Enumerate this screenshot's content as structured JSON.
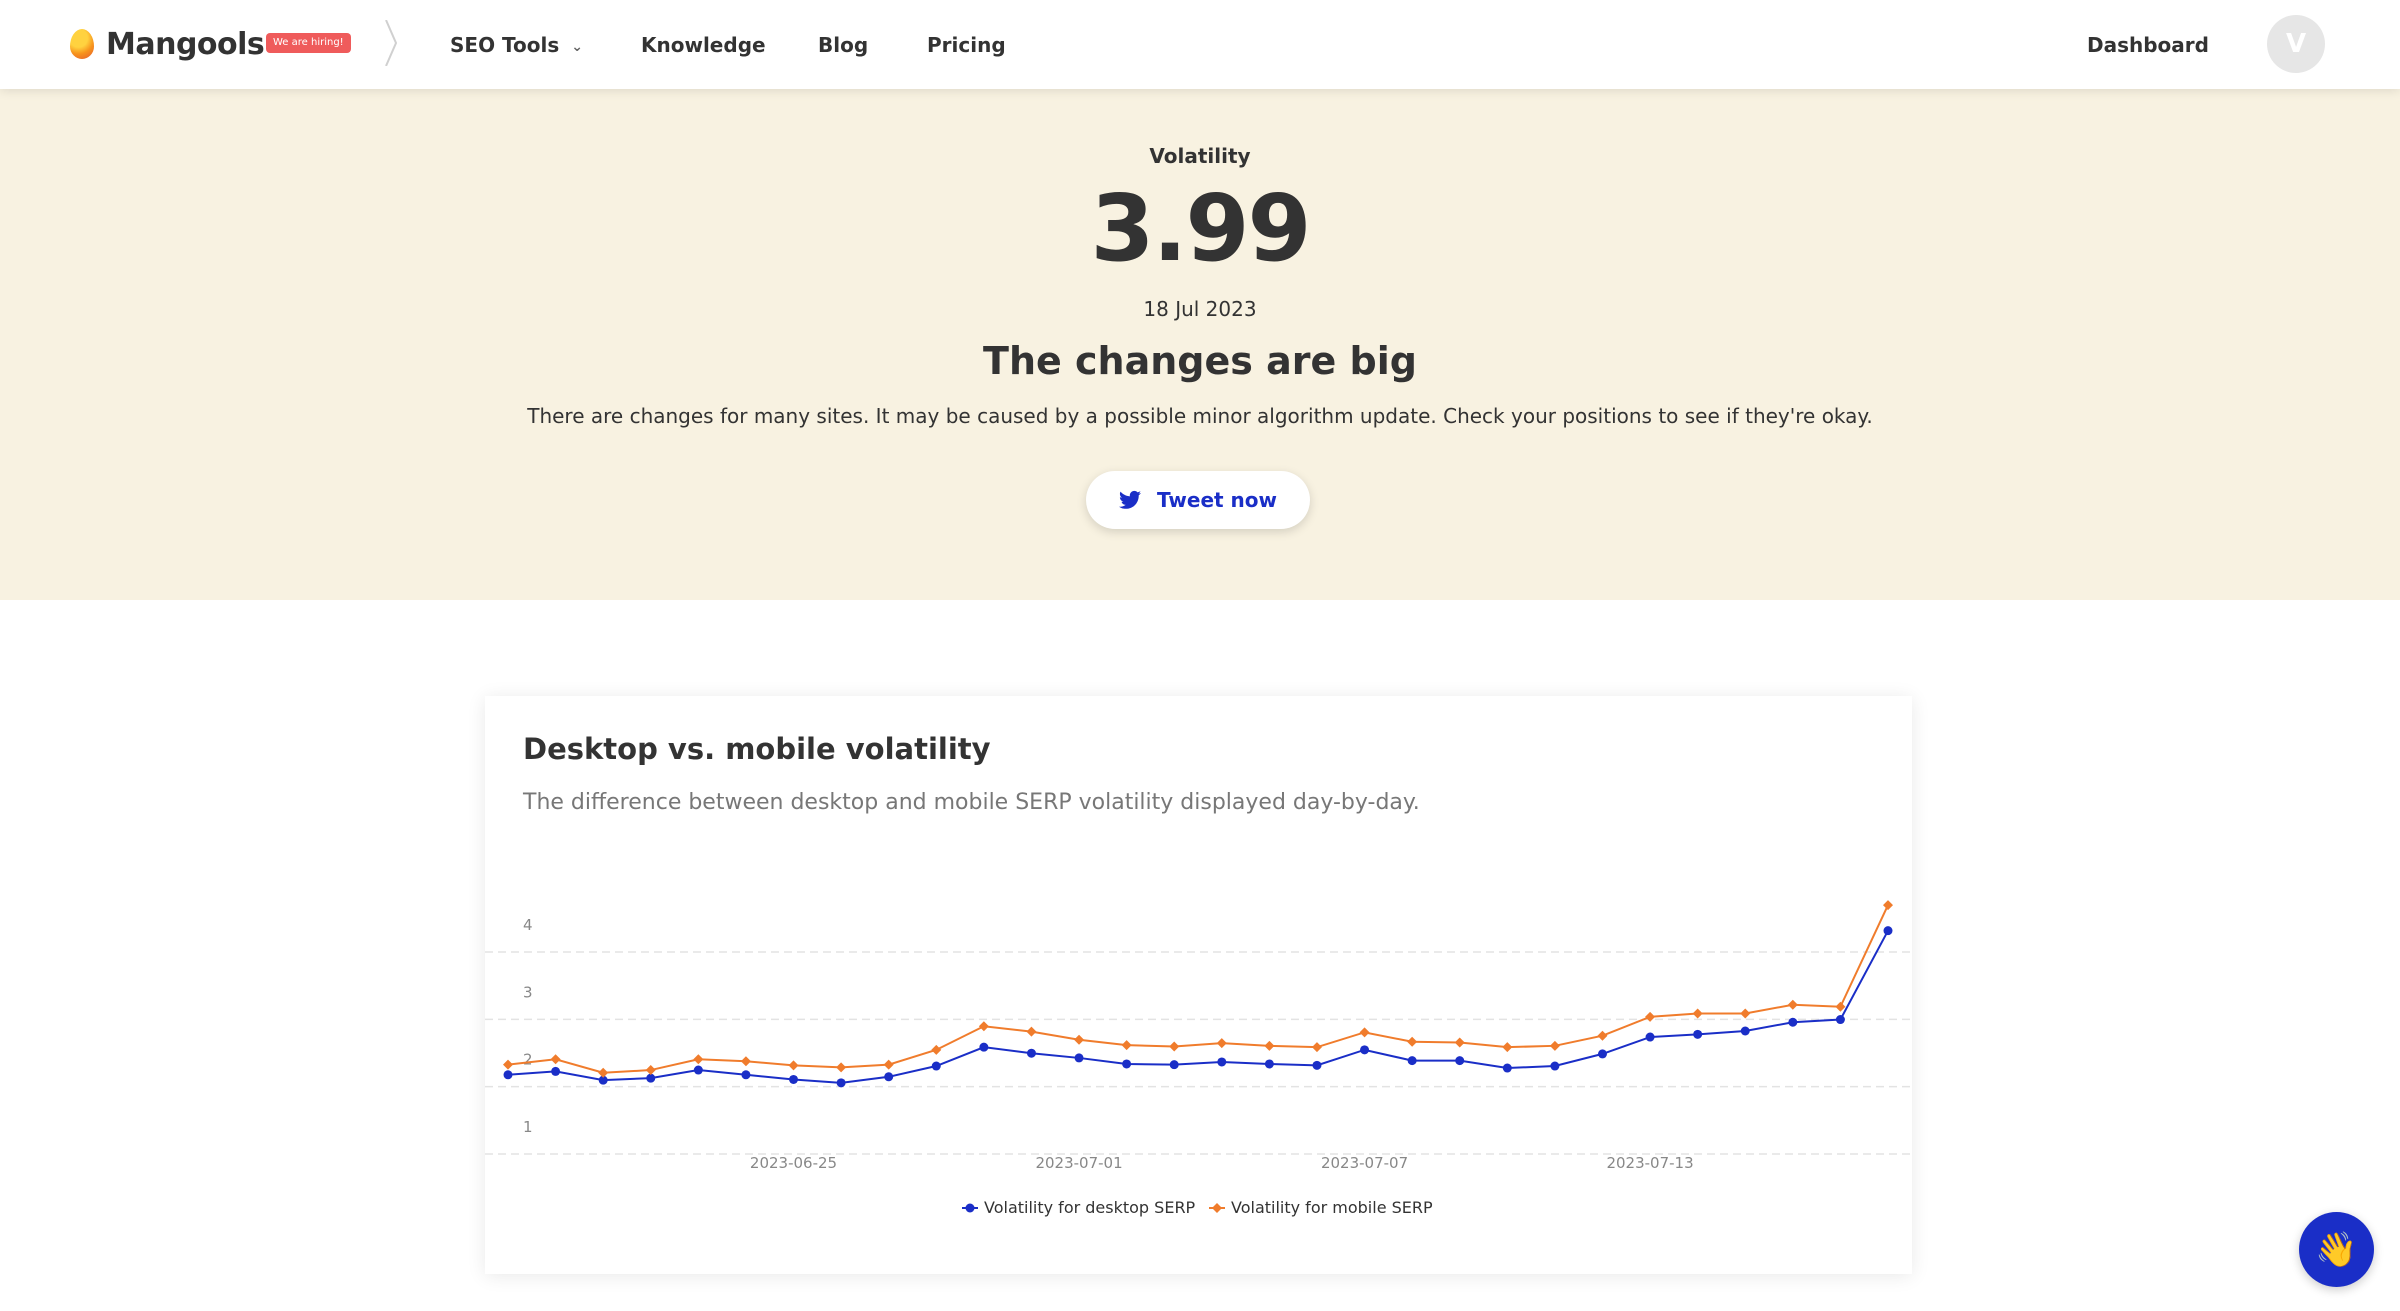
{
  "header": {
    "logo_text": "Mangools",
    "hiring_badge": "We are hiring!",
    "nav": {
      "seo_tools": "SEO Tools",
      "knowledge": "Knowledge",
      "blog": "Blog",
      "pricing": "Pricing",
      "dashboard": "Dashboard"
    },
    "avatar_initial": "V"
  },
  "hero": {
    "label": "Volatility",
    "value": "3.99",
    "date": "18 Jul 2023",
    "title": "The changes are big",
    "description": "There are changes for many sites. It may be caused by a possible minor algorithm update. Check your positions to see if they're okay.",
    "tweet_button": "Tweet now"
  },
  "card": {
    "title": "Desktop vs. mobile volatility",
    "subtitle": "The difference between desktop and mobile SERP volatility displayed day-by-day."
  },
  "colors": {
    "desktop": "#1a2ec7",
    "mobile": "#f07c2c",
    "hero_bg": "#f8f2e1"
  },
  "chart_data": {
    "type": "line",
    "x": [
      "2023-06-19",
      "2023-06-20",
      "2023-06-21",
      "2023-06-22",
      "2023-06-23",
      "2023-06-24",
      "2023-06-25",
      "2023-06-26",
      "2023-06-27",
      "2023-06-28",
      "2023-06-29",
      "2023-06-30",
      "2023-07-01",
      "2023-07-02",
      "2023-07-03",
      "2023-07-04",
      "2023-07-05",
      "2023-07-06",
      "2023-07-07",
      "2023-07-08",
      "2023-07-09",
      "2023-07-10",
      "2023-07-11",
      "2023-07-12",
      "2023-07-13",
      "2023-07-14",
      "2023-07-15",
      "2023-07-16",
      "2023-07-17",
      "2023-07-18"
    ],
    "series": [
      {
        "name": "Volatility for desktop SERP",
        "values": [
          1.85,
          1.9,
          1.77,
          1.8,
          1.92,
          1.85,
          1.78,
          1.73,
          1.82,
          1.98,
          2.26,
          2.17,
          2.1,
          2.01,
          2.0,
          2.04,
          2.01,
          1.99,
          2.22,
          2.06,
          2.06,
          1.95,
          1.98,
          2.16,
          2.41,
          2.45,
          2.5,
          2.63,
          2.67,
          3.99
        ]
      },
      {
        "name": "Volatility for mobile SERP",
        "values": [
          2.0,
          2.08,
          1.88,
          1.92,
          2.08,
          2.05,
          1.99,
          1.96,
          2.0,
          2.22,
          2.57,
          2.49,
          2.37,
          2.29,
          2.27,
          2.32,
          2.28,
          2.26,
          2.48,
          2.34,
          2.33,
          2.26,
          2.28,
          2.43,
          2.71,
          2.76,
          2.76,
          2.89,
          2.86,
          4.37
        ]
      }
    ],
    "xticks": [
      "2023-06-25",
      "2023-07-01",
      "2023-07-07",
      "2023-07-13"
    ],
    "yticks": [
      1,
      2,
      3,
      4
    ],
    "ylim": [
      1,
      4.5
    ],
    "grid": true,
    "legend": "bottom-center"
  }
}
